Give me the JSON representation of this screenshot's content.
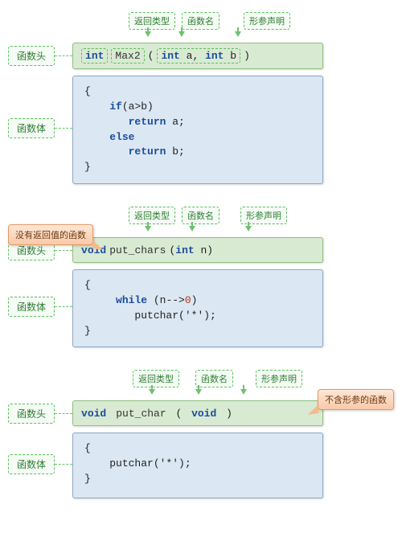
{
  "labels": {
    "return_type": "返回类型",
    "func_name": "函数名",
    "param_decl": "形参声明",
    "header": "函数头",
    "body": "函数体"
  },
  "callouts": {
    "no_return": "没有返回值的函数",
    "no_params": "不含形参的函数"
  },
  "ex1": {
    "ret": "int",
    "name": "Max2",
    "params": "int a, int b",
    "body": "{\n    if(a>b)\n       return a;\n    else\n       return b;\n}"
  },
  "ex2": {
    "ret": "void",
    "name": "put_chars",
    "params": "int n",
    "body_pre": "{\n     while (n-->",
    "body_zero": "0",
    "body_post": ")\n        putchar('*');\n}"
  },
  "ex3": {
    "ret": "void",
    "name": "put_char",
    "params": "void",
    "body": "{\n    putchar('*');\n}"
  }
}
